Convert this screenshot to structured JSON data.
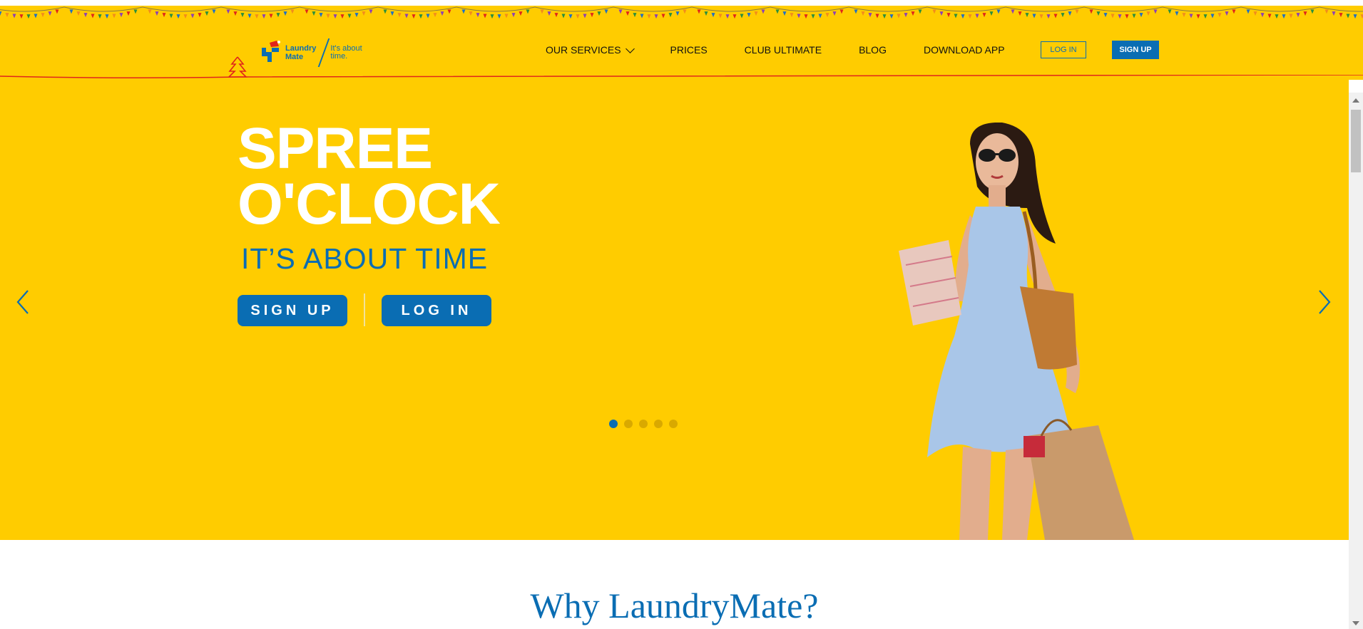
{
  "brand": {
    "logo_name_line1": "Laundry",
    "logo_name_line2": "Mate",
    "logo_tagline_line1": "It's about",
    "logo_tagline_line2": "time."
  },
  "nav": {
    "items": [
      {
        "label": "OUR SERVICES",
        "has_dropdown": true
      },
      {
        "label": "PRICES"
      },
      {
        "label": "CLUB ULTIMATE"
      },
      {
        "label": "BLOG"
      },
      {
        "label": "DOWNLOAD APP"
      }
    ],
    "login_label": "LOG IN",
    "signup_label": "SIGN UP"
  },
  "hero": {
    "title_line1": "SPREE",
    "title_line2": "O'CLOCK",
    "subtitle": "IT’S ABOUT TIME",
    "signup_label": "SIGN UP",
    "login_label": "LOG IN",
    "slide_count": 5,
    "active_slide": 1
  },
  "section": {
    "heading": "Why LaundryMate?"
  },
  "colors": {
    "brand_yellow": "#ffcc00",
    "brand_blue": "#0a6db3",
    "accent_red": "#e0251b"
  },
  "icons": [
    "laundrymate-logo-icon",
    "christmas-tree-icon",
    "chevron-down-icon",
    "chevron-left-icon",
    "chevron-right-icon"
  ]
}
